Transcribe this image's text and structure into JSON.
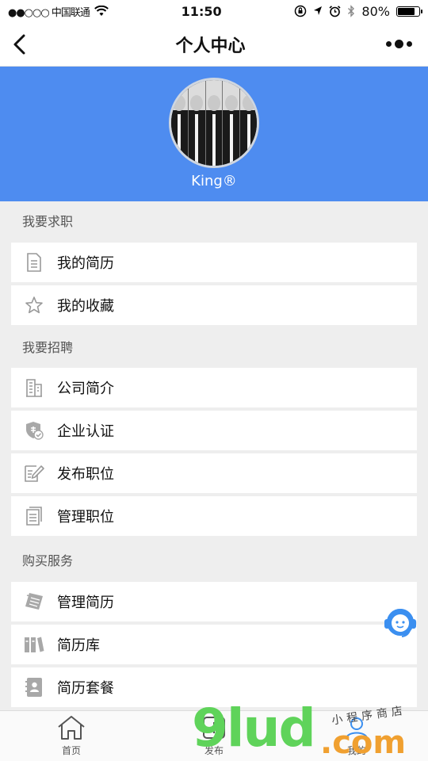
{
  "status_bar": {
    "carrier": "●●○○○ 中国联通",
    "time": "11:50",
    "battery": "80%",
    "battery_level": 0.8
  },
  "nav": {
    "title": "个人中心",
    "back_icon": "chevron-left-icon",
    "more_icon": "more-dots-icon"
  },
  "profile": {
    "username": "King®",
    "header_color": "#4e8cf0"
  },
  "sections": [
    {
      "title": "我要求职",
      "items": [
        {
          "label": "我的简历",
          "icon": "resume-icon"
        },
        {
          "label": "我的收藏",
          "icon": "star-icon"
        }
      ]
    },
    {
      "title": "我要招聘",
      "items": [
        {
          "label": "公司简介",
          "icon": "building-icon"
        },
        {
          "label": "企业认证",
          "icon": "shield-check-icon"
        },
        {
          "label": "发布职位",
          "icon": "edit-icon"
        },
        {
          "label": "管理职位",
          "icon": "documents-icon"
        }
      ]
    },
    {
      "title": "购买服务",
      "items": [
        {
          "label": "管理简历",
          "icon": "papers-icon"
        },
        {
          "label": "简历库",
          "icon": "books-icon"
        },
        {
          "label": "简历套餐",
          "icon": "contacts-icon"
        }
      ]
    }
  ],
  "tabs": [
    {
      "label": "首页",
      "icon": "home-icon"
    },
    {
      "label": "发布",
      "icon": "publish-icon"
    },
    {
      "label": "我的",
      "icon": "user-icon"
    }
  ],
  "watermark": {
    "big": "9lud",
    "com": ".com",
    "small": "小程序商店"
  }
}
